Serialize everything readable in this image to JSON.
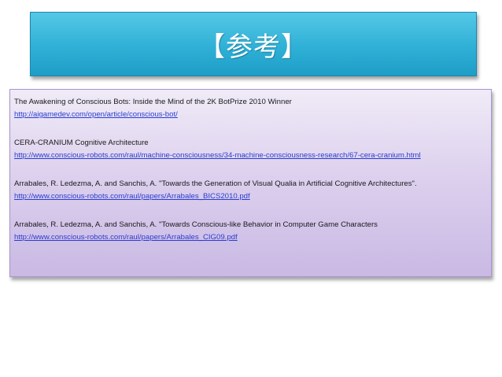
{
  "slide": {
    "title": "【参考】",
    "references": [
      {
        "title": "The Awakening of Conscious Bots: Inside the Mind of the 2K BotPrize 2010 Winner",
        "url": "http://aigamedev.com/open/article/conscious-bot/"
      },
      {
        "title": "CERA-CRANIUM Cognitive Architecture",
        "url": "http://www.conscious-robots.com/raul/machine-consciousness/34-machine-consciousness-research/67-cera-cranium.html"
      },
      {
        "title": "Arrabales, R. Ledezma, A. and Sanchis, A. \"Towards the Generation of Visual Qualia in Artificial Cognitive Architectures\".",
        "url": "http://www.conscious-robots.com/raul/papers/Arrabales_BICS2010.pdf"
      },
      {
        "title": "Arrabales, R. Ledezma, A. and Sanchis, A. \"Towards Conscious-like Behavior in Computer Game Characters",
        "url": "http://www.conscious-robots.com/raul/papers/Arrabales_CIG09.pdf"
      }
    ]
  },
  "colors": {
    "title_bg": "#2fb0d6",
    "content_bg": "#ddd1ee",
    "link": "#2a3dcf"
  }
}
